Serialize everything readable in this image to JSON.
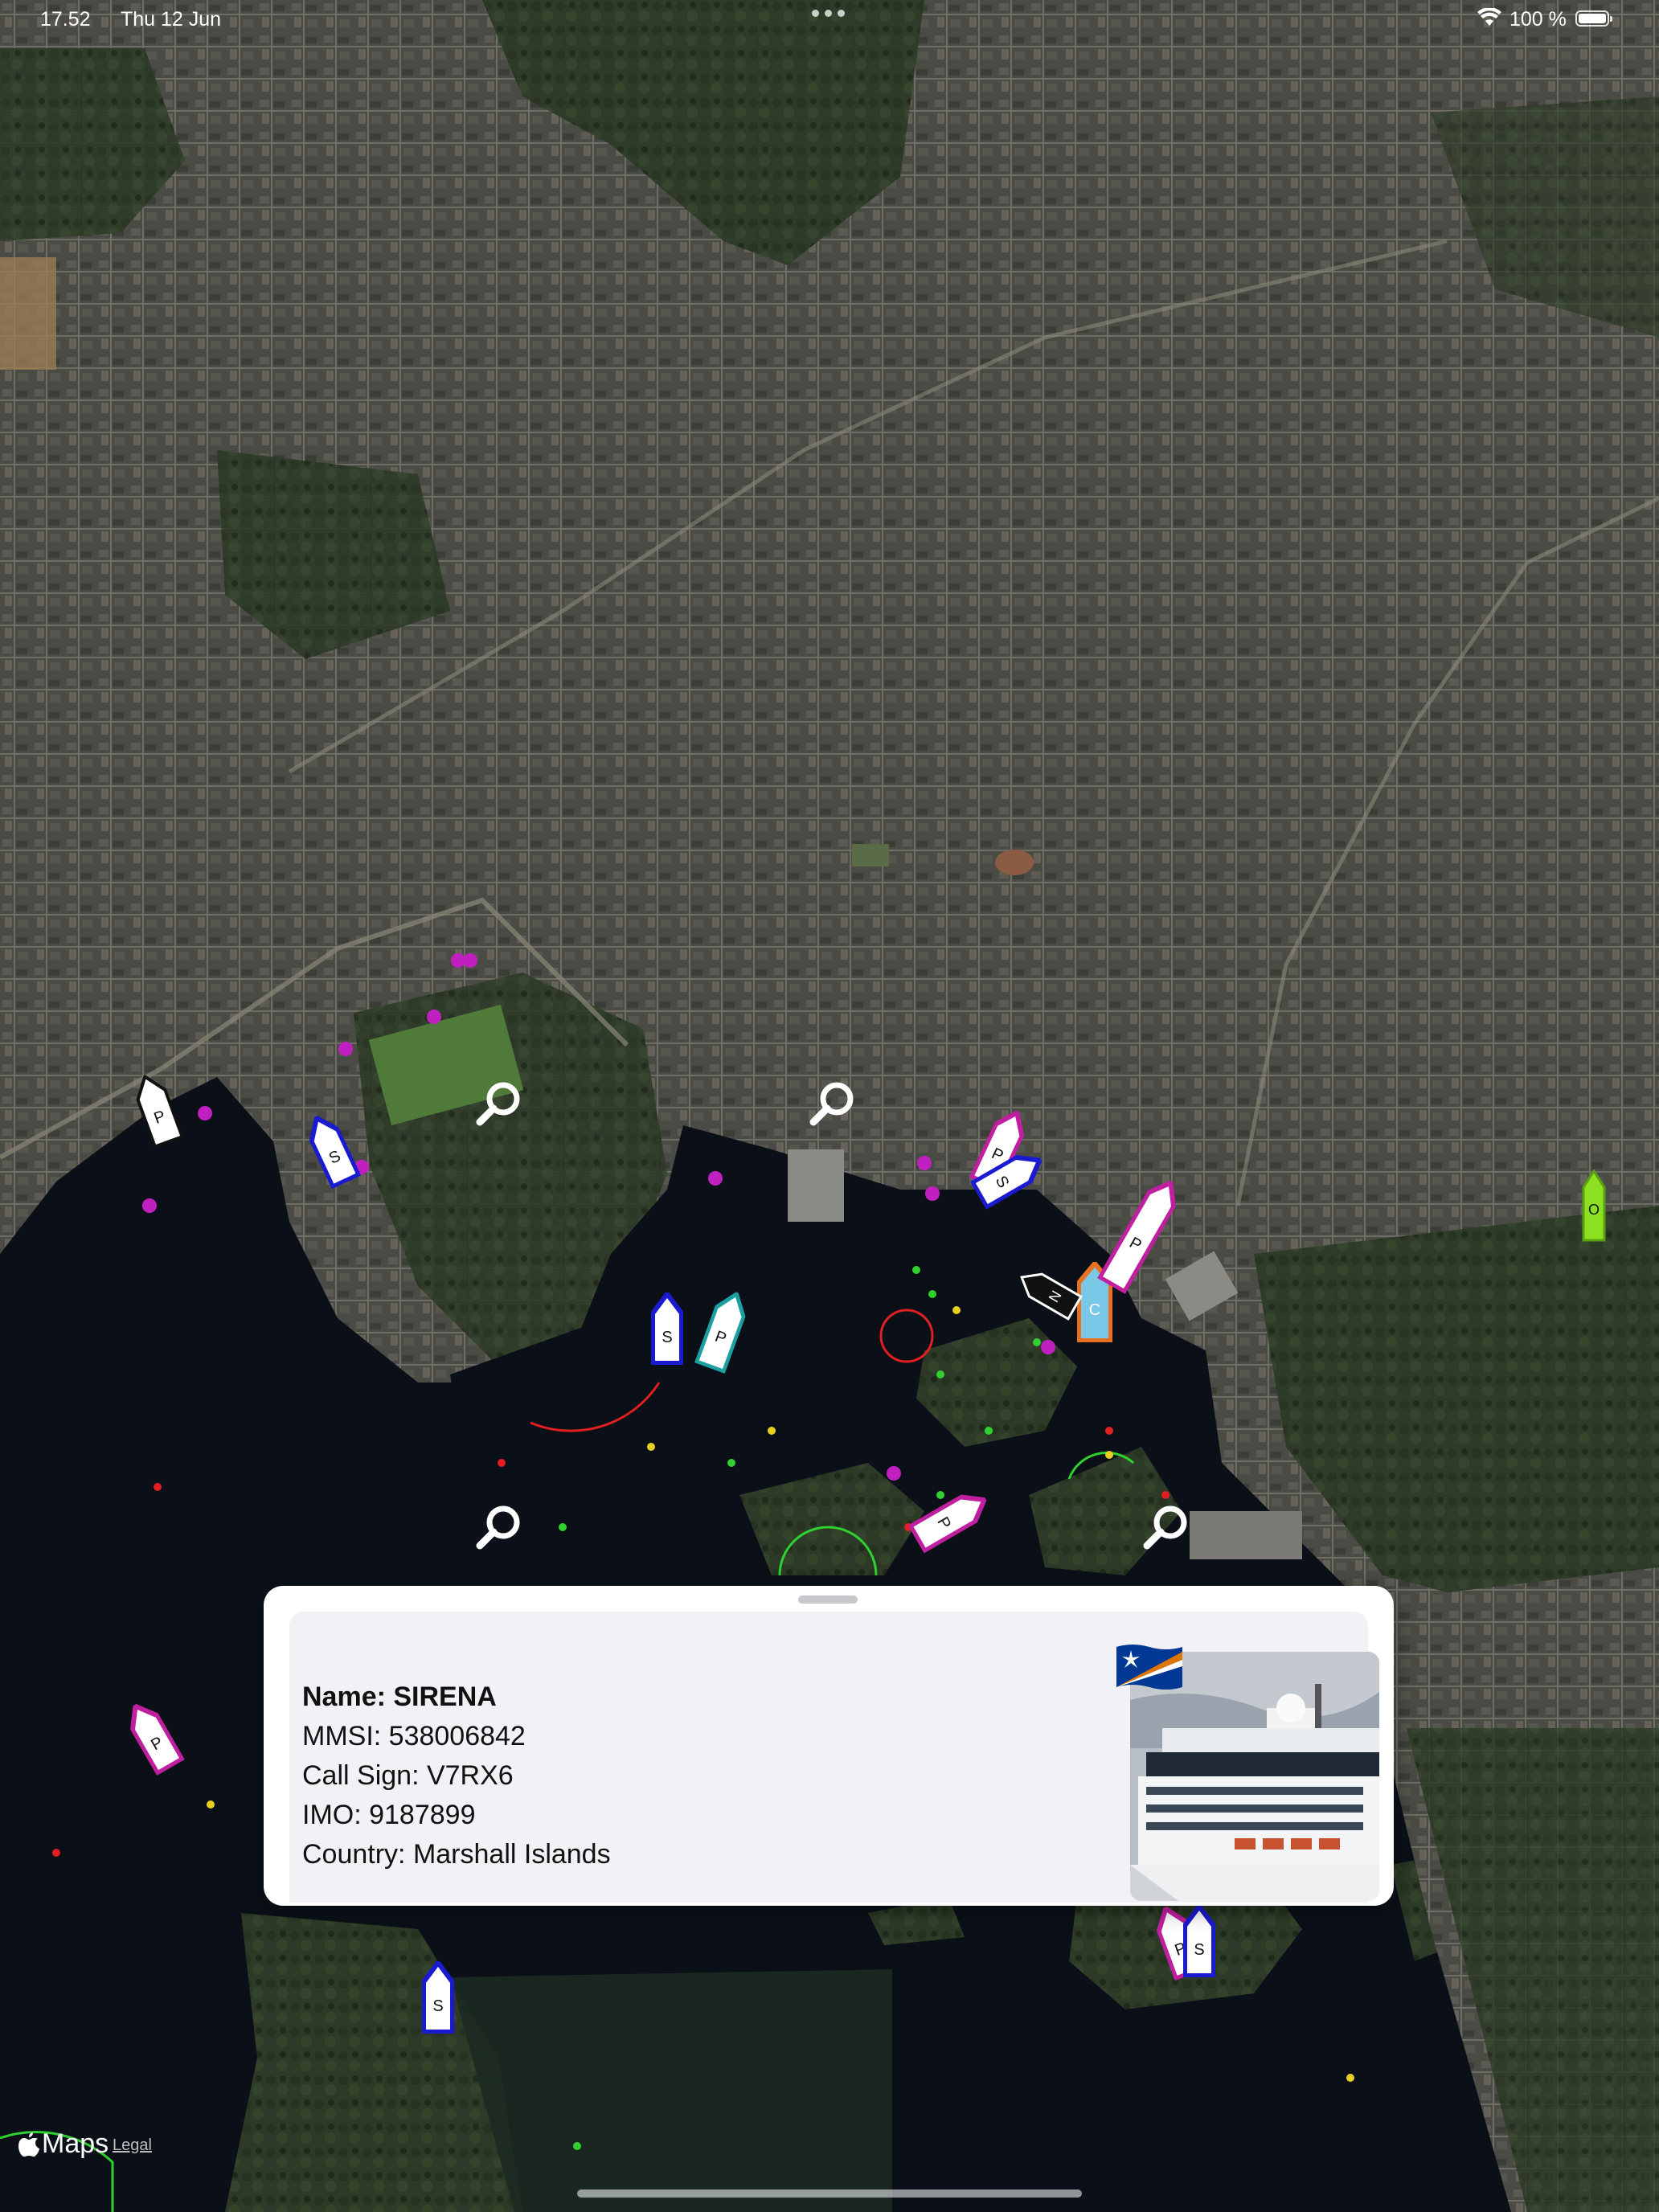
{
  "status_bar": {
    "time": "17.52",
    "date": "Thu 12 Jun",
    "battery_percent": "100 %",
    "battery_level": 1.0
  },
  "map": {
    "app_name": "Maps",
    "legal_label": "Legal",
    "water_color": "#0b1018",
    "land_color": "#3e4436"
  },
  "vessels": [
    {
      "label": "P"
    },
    {
      "label": "S"
    },
    {
      "label": "S"
    },
    {
      "label": "P"
    },
    {
      "label": "P"
    },
    {
      "label": "C"
    },
    {
      "label": "N"
    },
    {
      "label": "P"
    },
    {
      "label": "P"
    },
    {
      "label": "S"
    },
    {
      "label": "O"
    },
    {
      "label": "P"
    },
    {
      "label": "S"
    },
    {
      "label": "P"
    },
    {
      "label": "S"
    }
  ],
  "info_panel": {
    "name_label": "Name: SIRENA",
    "mmsi_label": "MMSI: 538006842",
    "call_sign_label": "Call Sign: V7RX6",
    "imo_label": "IMO: 9187899",
    "country_label": "Country: Marshall Islands",
    "flag_icon": "marshall-islands-flag-icon",
    "flag_colors": {
      "blue": "#003893",
      "orange": "#dd7500",
      "white": "#ffffff"
    }
  }
}
